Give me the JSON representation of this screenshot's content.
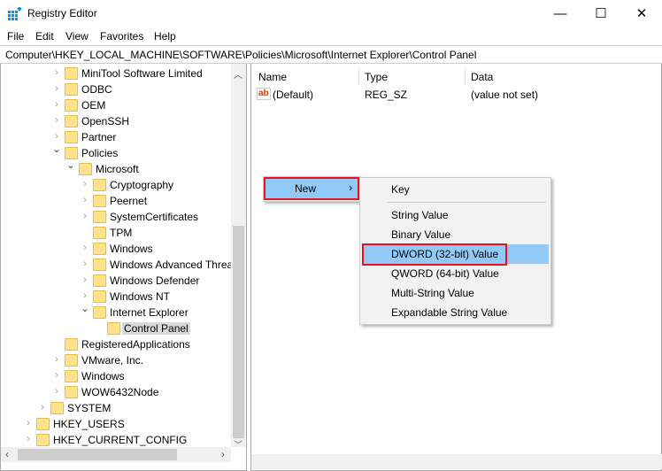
{
  "window": {
    "title": "Registry Editor",
    "minimize": "—",
    "maximize": "☐",
    "close": "✕"
  },
  "menubar": [
    "File",
    "Edit",
    "View",
    "Favorites",
    "Help"
  ],
  "address": "Computer\\HKEY_LOCAL_MACHINE\\SOFTWARE\\Policies\\Microsoft\\Internet Explorer\\Control Panel",
  "tree": [
    {
      "label": "MiniTool Software Limited",
      "level": 2,
      "state": "collapsed"
    },
    {
      "label": "ODBC",
      "level": 2,
      "state": "collapsed"
    },
    {
      "label": "OEM",
      "level": 2,
      "state": "collapsed"
    },
    {
      "label": "OpenSSH",
      "level": 2,
      "state": "collapsed"
    },
    {
      "label": "Partner",
      "level": 2,
      "state": "collapsed"
    },
    {
      "label": "Policies",
      "level": 2,
      "state": "expanded"
    },
    {
      "label": "Microsoft",
      "level": 3,
      "state": "expanded"
    },
    {
      "label": "Cryptography",
      "level": 4,
      "state": "collapsed"
    },
    {
      "label": "Peernet",
      "level": 4,
      "state": "collapsed"
    },
    {
      "label": "SystemCertificates",
      "level": 4,
      "state": "collapsed"
    },
    {
      "label": "TPM",
      "level": 4,
      "state": "leaf"
    },
    {
      "label": "Windows",
      "level": 4,
      "state": "collapsed"
    },
    {
      "label": "Windows Advanced Threat Protection",
      "level": 4,
      "state": "collapsed"
    },
    {
      "label": "Windows Defender",
      "level": 4,
      "state": "collapsed"
    },
    {
      "label": "Windows NT",
      "level": 4,
      "state": "collapsed"
    },
    {
      "label": "Internet Explorer",
      "level": 4,
      "state": "expanded"
    },
    {
      "label": "Control Panel",
      "level": 5,
      "state": "leaf",
      "selected": true
    },
    {
      "label": "RegisteredApplications",
      "level": 2,
      "state": "leaf"
    },
    {
      "label": "VMware, Inc.",
      "level": 2,
      "state": "collapsed"
    },
    {
      "label": "Windows",
      "level": 2,
      "state": "collapsed"
    },
    {
      "label": "WOW6432Node",
      "level": 2,
      "state": "collapsed"
    },
    {
      "label": "SYSTEM",
      "level": 1,
      "state": "collapsed"
    },
    {
      "label": "HKEY_USERS",
      "level": 0,
      "state": "collapsed"
    },
    {
      "label": "HKEY_CURRENT_CONFIG",
      "level": 0,
      "state": "collapsed"
    }
  ],
  "values": {
    "columns": [
      "Name",
      "Type",
      "Data"
    ],
    "rows": [
      {
        "name": "(Default)",
        "type": "REG_SZ",
        "data": "(value not set)",
        "icon": "ab"
      }
    ]
  },
  "context_menu": {
    "new_label": "New",
    "arrow": "›"
  },
  "submenu": [
    {
      "label": "Key"
    },
    {
      "separator": true
    },
    {
      "label": "String Value"
    },
    {
      "label": "Binary Value"
    },
    {
      "label": "DWORD (32-bit) Value",
      "highlighted": true
    },
    {
      "label": "QWORD (64-bit) Value"
    },
    {
      "label": "Multi-String Value"
    },
    {
      "label": "Expandable String Value"
    }
  ],
  "colors": {
    "highlight": "#91c9f7",
    "annotation": "#e81123",
    "folder": "#ffe28a"
  }
}
